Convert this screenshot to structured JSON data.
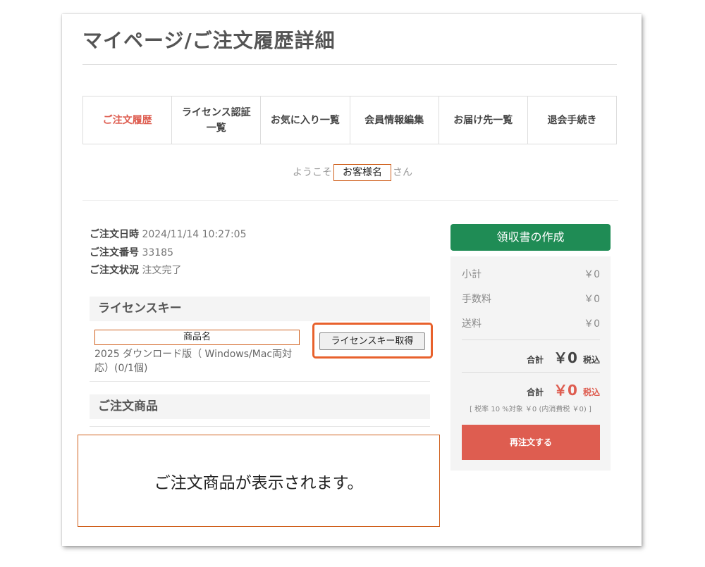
{
  "page_title": "マイページ/ご注文履歴詳細",
  "tabs": [
    {
      "label": "ご注文履歴",
      "active": true
    },
    {
      "label": "ライセンス認証\n一覧",
      "active": false
    },
    {
      "label": "お気に入り一覧",
      "active": false
    },
    {
      "label": "会員情報編集",
      "active": false
    },
    {
      "label": "お届け先一覧",
      "active": false
    },
    {
      "label": "退会手続き",
      "active": false
    }
  ],
  "welcome": {
    "prefix": "ようこそ",
    "name": "お客様名",
    "suffix": "さん"
  },
  "order": {
    "date_label": "ご注文日時",
    "date_value": "2024/11/14 10:27:05",
    "number_label": "ご注文番号",
    "number_value": "33185",
    "status_label": "ご注文状況",
    "status_value": "注文完了"
  },
  "license_section": {
    "title": "ライセンスキー",
    "product_name": "商品名",
    "product_desc": "2025 ダウンロード版（ Windows/Mac両対応）(0/1個)",
    "button_label": "ライセンスキー取得"
  },
  "products_section": {
    "title": "ご注文商品",
    "placeholder": "ご注文商品が表示されます。"
  },
  "summary": {
    "receipt_button": "領収書の作成",
    "subtotal_label": "小計",
    "subtotal_value": "￥0",
    "fee_label": "手数料",
    "fee_value": "￥0",
    "shipping_label": "送料",
    "shipping_value": "￥0",
    "total_label": "合計",
    "total_value": "￥0",
    "tax_label": "税込",
    "grand_total_label": "合計",
    "grand_total_value": "￥0",
    "grand_tax_label": "税込",
    "tax_note": "[ 税率 10 %対象 ￥0 (内消費税 ￥0) ]",
    "reorder_button": "再注文する"
  },
  "colors": {
    "accent_red": "#de5d50",
    "green": "#1f8c55",
    "highlight_orange": "#e8612c"
  }
}
